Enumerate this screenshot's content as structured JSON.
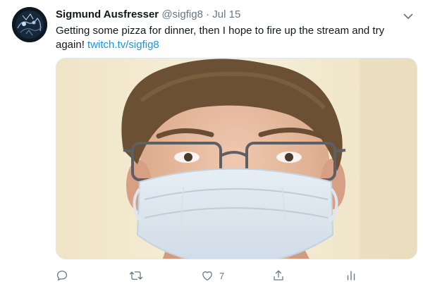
{
  "tweet": {
    "author": {
      "name": "Sigmund Ausfresser",
      "handle": "@sigfig8"
    },
    "separator": "·",
    "date": "Jul 15",
    "text": "Getting some pizza for dinner, then I hope to fire up the stream and try again!",
    "link": "twitch.tv/sigfig8",
    "actions": {
      "reply": {
        "icon": "reply-icon"
      },
      "retweet": {
        "icon": "retweet-icon"
      },
      "like": {
        "icon": "heart-icon",
        "count": "7"
      },
      "share": {
        "icon": "share-icon"
      },
      "analytics": {
        "icon": "analytics-icon"
      }
    },
    "menu_icon": "chevron-down-icon"
  },
  "colors": {
    "text": "#14171a",
    "secondary": "#657786",
    "link": "#1b95e0"
  }
}
